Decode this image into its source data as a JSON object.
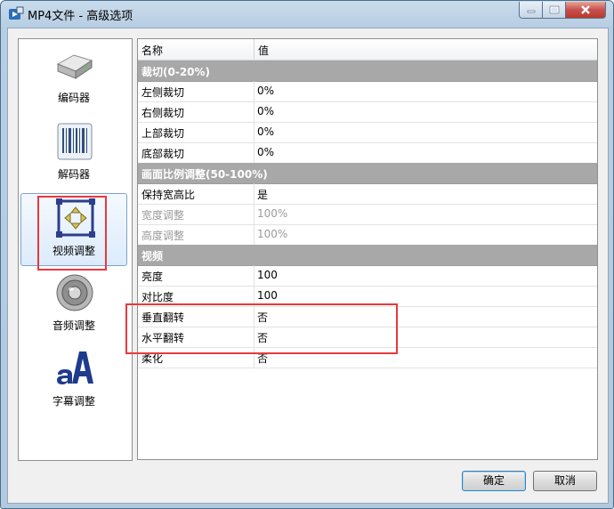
{
  "window": {
    "title": "MP4文件 - 高级选项"
  },
  "sidebar": {
    "items": [
      {
        "label": "编码器",
        "icon": "encoder-drive-icon"
      },
      {
        "label": "解码器",
        "icon": "decoder-barcode-icon"
      },
      {
        "label": "视频调整",
        "icon": "video-crop-icon",
        "selected": true
      },
      {
        "label": "音频调整",
        "icon": "speaker-icon"
      },
      {
        "label": "字幕调整",
        "icon": "subtitle-font-icon"
      }
    ]
  },
  "grid": {
    "headers": {
      "name": "名称",
      "value": "值"
    },
    "rows": [
      {
        "type": "category",
        "name": "裁切(0-20%)"
      },
      {
        "name": "左侧裁切",
        "value": "0%"
      },
      {
        "name": "右侧裁切",
        "value": "0%"
      },
      {
        "name": "上部裁切",
        "value": "0%"
      },
      {
        "name": "底部裁切",
        "value": "0%"
      },
      {
        "type": "category",
        "name": "画面比例调整(50-100%)"
      },
      {
        "name": "保持宽高比",
        "value": "是"
      },
      {
        "name": "宽度调整",
        "value": "100%",
        "disabled": true
      },
      {
        "name": "高度调整",
        "value": "100%",
        "disabled": true
      },
      {
        "type": "category",
        "name": "视频"
      },
      {
        "name": "亮度",
        "value": "100"
      },
      {
        "name": "对比度",
        "value": "100"
      },
      {
        "name": "垂直翻转",
        "value": "否"
      },
      {
        "name": "水平翻转",
        "value": "否"
      },
      {
        "name": "柔化",
        "value": "否"
      }
    ]
  },
  "buttons": {
    "ok": "确定",
    "cancel": "取消"
  },
  "colors": {
    "highlight": "#e8393d",
    "category_bg": "#a8a8a8",
    "title_bar": "#b7cde2"
  }
}
